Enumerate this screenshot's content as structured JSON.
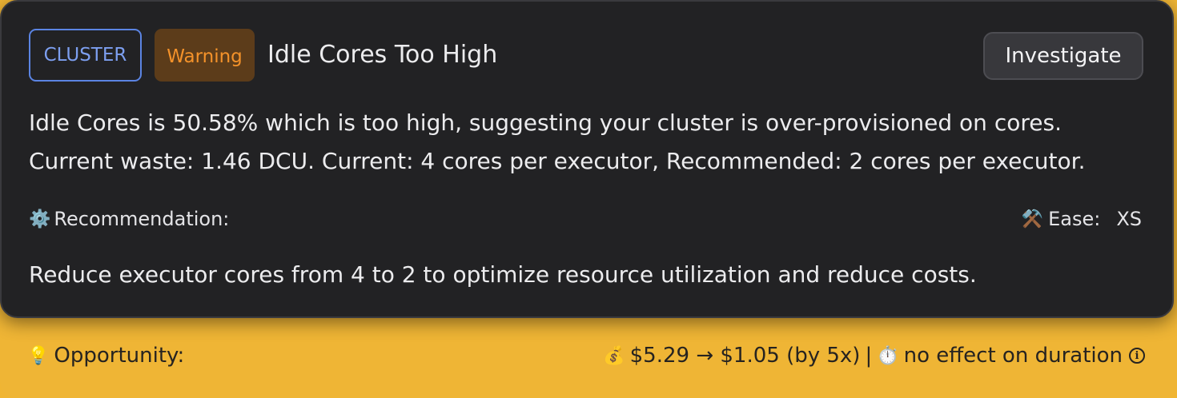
{
  "card": {
    "category_tag": "CLUSTER",
    "severity_tag": "Warning",
    "title": "Idle Cores Too High",
    "action_button": "Investigate",
    "description_line1": "Idle Cores is 50.58% which is too high, suggesting your cluster is over-provisioned on cores.",
    "description_line2": "Current waste: 1.46 DCU. Current: 4 cores per executor, Recommended: 2 cores per executor.",
    "recommendation_icon": "⚙️",
    "recommendation_label": "Recommendation:",
    "ease_icon": "⚒️",
    "ease_label": "Ease:",
    "ease_value": "XS",
    "recommendation_text": "Reduce executor cores from 4 to 2 to optimize resource utilization and reduce costs."
  },
  "opportunity": {
    "icon": "💡",
    "label": "Opportunity:",
    "money_icon": "💰",
    "cost_change": "$5.29 → $1.05 (by 5x)",
    "separator": "|",
    "timer_icon": "⏱️",
    "duration_effect": "no effect on duration"
  },
  "colors": {
    "card_bg": "#222224",
    "footer_bg": "#efb535",
    "cluster_tag": "#5b84e3",
    "warning_bg": "#5c3c1a",
    "warning_text": "#f4922a"
  }
}
